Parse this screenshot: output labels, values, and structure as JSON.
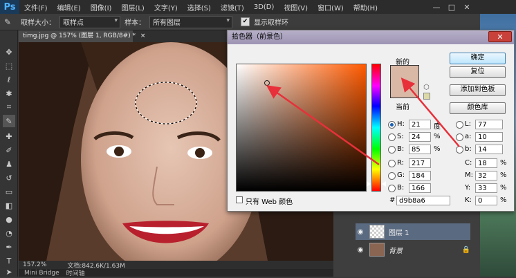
{
  "app": {
    "logo": "Ps"
  },
  "menu": [
    "文件(F)",
    "编辑(E)",
    "图像(I)",
    "图层(L)",
    "文字(Y)",
    "选择(S)",
    "滤镜(T)",
    "3D(D)",
    "视图(V)",
    "窗口(W)",
    "帮助(H)"
  ],
  "window_controls": {
    "minimize": "—",
    "maximize": "□",
    "close": "✕"
  },
  "options": {
    "sample_size_label": "取样大小：",
    "sample_size_value": "取样点",
    "sample_label": "样本：",
    "sample_value": "所有图层",
    "show_ring_checked": "✔",
    "show_ring_label": "显示取样环"
  },
  "document": {
    "tab_title": "timg.jpg @ 157% (图层 1, RGB/8#) *",
    "tab_close": "×",
    "zoom": "157.2%",
    "doc_info": "文档:842.6K/1.63M"
  },
  "bottom_tabs": [
    "Mini Bridge",
    "时间轴"
  ],
  "layers": [
    {
      "name": "图层 1"
    },
    {
      "name": "背景"
    }
  ],
  "color_picker": {
    "title": "拾色器（前景色）",
    "new_label": "新的",
    "current_label": "当前",
    "buttons": {
      "ok": "确定",
      "reset": "复位",
      "add_swatch": "添加到色板",
      "libraries": "颜色库"
    },
    "fields": {
      "H": "21",
      "S": "24",
      "B": "85",
      "R": "217",
      "G": "184",
      "Bl": "166",
      "L": "77",
      "a": "10",
      "b": "14",
      "C": "18",
      "M": "32",
      "Y": "33",
      "K": "0"
    },
    "labels": {
      "H": "H:",
      "S": "S:",
      "B": "B:",
      "R": "R:",
      "G": "G:",
      "Bl": "B:",
      "L": "L:",
      "a": "a:",
      "b": "b:",
      "C": "C:",
      "M": "M:",
      "Y": "Y:",
      "K": "K:"
    },
    "units": {
      "deg": "度",
      "pct": "%"
    },
    "hex_label": "#",
    "hex": "d9b8a6",
    "web_only": "只有 Web 颜色",
    "close": "✕"
  },
  "colors": {
    "new_color": "#d9b8a6",
    "annotation_arrow": "#e8303a"
  }
}
